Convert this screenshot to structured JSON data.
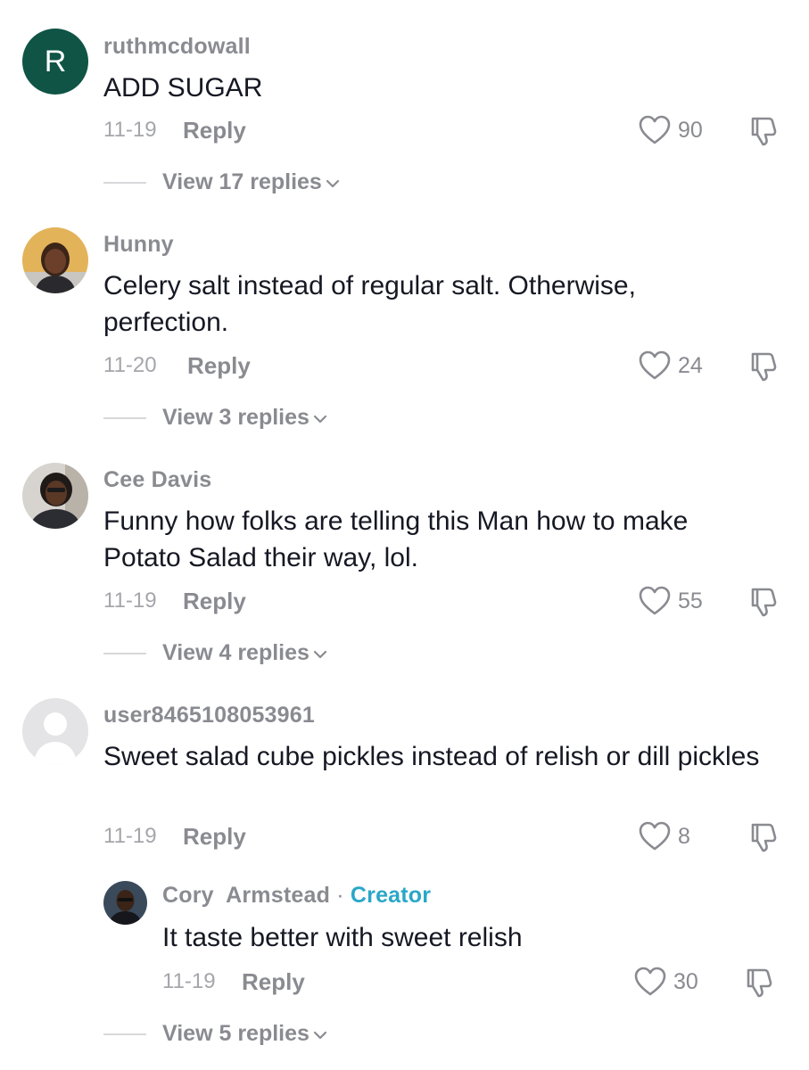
{
  "comments": [
    {
      "username": "ruthmcdowall",
      "avatar_letter": "R",
      "text": "ADD SUGAR",
      "date": "11-19",
      "reply_label": "Reply",
      "likes": "90",
      "view_replies": "View 17 replies"
    },
    {
      "username": "Hunny",
      "text": "Celery salt instead of regular salt. Otherwise, perfection.",
      "date": "11-20",
      "reply_label": "Reply",
      "likes": "24",
      "view_replies": "View 3 replies"
    },
    {
      "username": "Cee Davis",
      "text": "Funny how folks are telling this Man how to make Potato Salad their way, lol.",
      "date": "11-19",
      "reply_label": "Reply",
      "likes": "55",
      "view_replies": "View 4 replies"
    },
    {
      "username": "user8465108053961",
      "text": "Sweet salad cube pickles instead of relish or dill pickles",
      "date": "11-19",
      "reply_label": "Reply",
      "likes": "8"
    }
  ],
  "creator_reply": {
    "username": "Cory  Armstead",
    "separator": "·",
    "badge": "Creator",
    "text": "It taste better with sweet relish",
    "date": "11-19",
    "reply_label": "Reply",
    "likes": "30",
    "view_replies": "View 5 replies"
  },
  "icons": {
    "like": "heart-outline-icon",
    "dislike": "thumbs-down-icon",
    "expand": "chevron-down-icon"
  },
  "colors": {
    "avatar_r": "#0f5445",
    "creator_badge": "#2aa7c8",
    "meta_text": "#8a8b91"
  }
}
